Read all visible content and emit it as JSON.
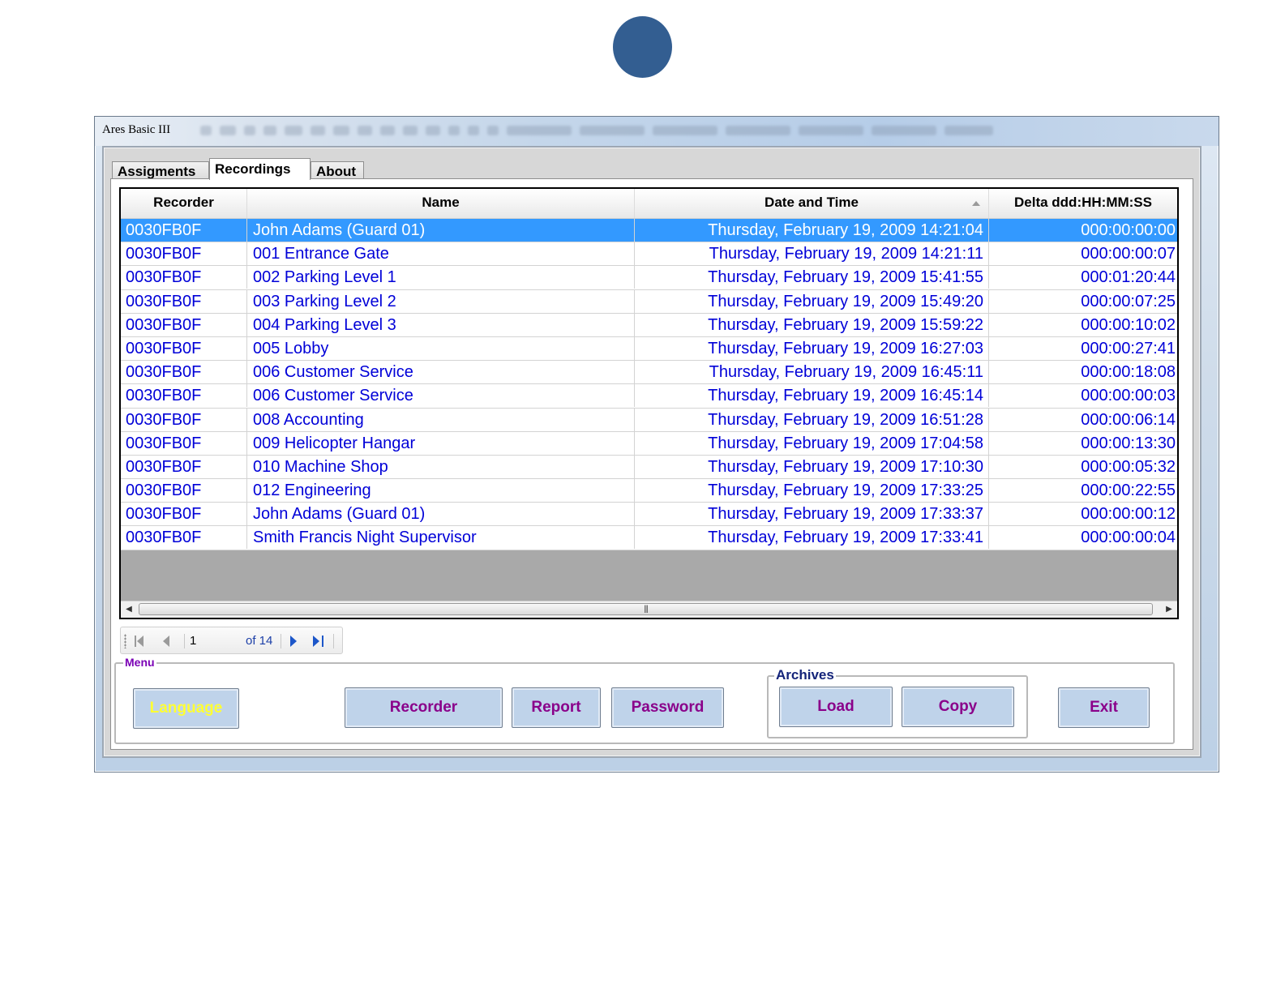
{
  "window": {
    "title": "Ares Basic III"
  },
  "tabs": [
    {
      "label": "Assigments"
    },
    {
      "label": "Recordings"
    },
    {
      "label": "About"
    }
  ],
  "grid": {
    "columns": [
      "Recorder",
      "Name",
      "Date and Time",
      "Delta ddd:HH:MM:SS"
    ],
    "sorted_column": "Date and Time",
    "selection_color": "#3399ff",
    "text_color": "#0000d8",
    "rows": [
      {
        "recorder": "0030FB0F",
        "name": "John Adams (Guard 01)",
        "datetime": "Thursday, February 19, 2009 14:21:04",
        "delta": "000:00:00:00",
        "selected": true
      },
      {
        "recorder": "0030FB0F",
        "name": "001 Entrance Gate",
        "datetime": "Thursday, February 19, 2009 14:21:11",
        "delta": "000:00:00:07"
      },
      {
        "recorder": "0030FB0F",
        "name": "002 Parking Level 1",
        "datetime": "Thursday, February 19, 2009 15:41:55",
        "delta": "000:01:20:44"
      },
      {
        "recorder": "0030FB0F",
        "name": "003 Parking Level 2",
        "datetime": "Thursday, February 19, 2009 15:49:20",
        "delta": "000:00:07:25"
      },
      {
        "recorder": "0030FB0F",
        "name": "004 Parking Level 3",
        "datetime": "Thursday, February 19, 2009 15:59:22",
        "delta": "000:00:10:02"
      },
      {
        "recorder": "0030FB0F",
        "name": "005 Lobby",
        "datetime": "Thursday, February 19, 2009 16:27:03",
        "delta": "000:00:27:41"
      },
      {
        "recorder": "0030FB0F",
        "name": "006 Customer Service",
        "datetime": "Thursday, February 19, 2009 16:45:11",
        "delta": "000:00:18:08"
      },
      {
        "recorder": "0030FB0F",
        "name": "006 Customer Service",
        "datetime": "Thursday, February 19, 2009 16:45:14",
        "delta": "000:00:00:03"
      },
      {
        "recorder": "0030FB0F",
        "name": "008 Accounting",
        "datetime": "Thursday, February 19, 2009 16:51:28",
        "delta": "000:00:06:14"
      },
      {
        "recorder": "0030FB0F",
        "name": "009 Helicopter Hangar",
        "datetime": "Thursday, February 19, 2009 17:04:58",
        "delta": "000:00:13:30"
      },
      {
        "recorder": "0030FB0F",
        "name": "010 Machine Shop",
        "datetime": "Thursday, February 19, 2009 17:10:30",
        "delta": "000:00:05:32"
      },
      {
        "recorder": "0030FB0F",
        "name": "012 Engineering",
        "datetime": "Thursday, February 19, 2009 17:33:25",
        "delta": "000:00:22:55"
      },
      {
        "recorder": "0030FB0F",
        "name": "John Adams (Guard 01)",
        "datetime": "Thursday, February 19, 2009 17:33:37",
        "delta": "000:00:00:12"
      },
      {
        "recorder": "0030FB0F",
        "name": "Smith Francis Night Supervisor",
        "datetime": "Thursday, February 19, 2009 17:33:41",
        "delta": "000:00:00:04"
      }
    ]
  },
  "pager": {
    "current_page": "1",
    "total_label": "of 14"
  },
  "menu": {
    "legend": "Menu",
    "language_label": "Language",
    "recorder_label": "Recorder",
    "report_label": "Report",
    "password_label": "Password",
    "exit_label": "Exit"
  },
  "archives": {
    "legend": "Archives",
    "load_label": "Load",
    "copy_label": "Copy"
  },
  "icons": {
    "pager_first": "first-page-icon",
    "pager_prev": "prev-page-icon",
    "pager_next": "next-page-icon",
    "pager_last": "last-page-icon",
    "scroll_left": "scroll-left-icon",
    "scroll_right": "scroll-right-icon"
  },
  "colors": {
    "button_text": "#8a008a",
    "language_text": "#ffff33",
    "menu_legend": "#7a00b5",
    "archives_legend": "#14247a",
    "accent_dot": "#335e91"
  }
}
